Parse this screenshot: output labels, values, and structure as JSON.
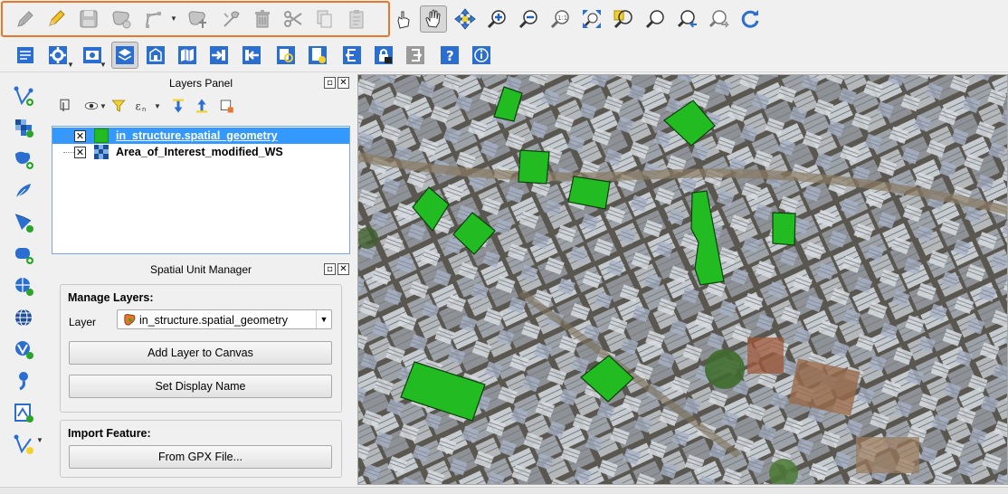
{
  "toolbar_top": {
    "edit_group": [
      "toggle-editing-icon",
      "pencil-icon",
      "save-edits-icon",
      "add-feature-icon",
      "node-tool-icon",
      "move-feature-icon",
      "vertex-tool-icon",
      "delete-icon",
      "cut-icon",
      "copy-icon",
      "paste-icon"
    ],
    "navigation": [
      "touch-icon",
      "pan-icon",
      "pan-to-selection-icon",
      "zoom-in-icon",
      "zoom-out-icon",
      "zoom-native-icon",
      "zoom-full-icon",
      "zoom-to-selection-icon",
      "zoom-to-layer-icon",
      "zoom-last-icon",
      "zoom-next-icon",
      "refresh-icon"
    ]
  },
  "toolbar_second": [
    "new-project-icon",
    "options-icon",
    "view-options-icon",
    "layers-panel-icon",
    "properties-icon",
    "map-options-icon",
    "import-icon",
    "export-icon",
    "search-icon",
    "document-icon",
    "back-icon",
    "lock-icon",
    "forward-icon",
    "help-icon",
    "info-icon"
  ],
  "left_toolbar": [
    "new-layer-icon",
    "raster-icon",
    "add-vector-icon",
    "feather-icon",
    "add-polygon-icon",
    "add-shape-icon",
    "wms-icon",
    "globe-icon",
    "vertex-edit-icon",
    "curve-icon",
    "map-edit-icon",
    "digitize-icon"
  ],
  "layers_panel": {
    "title": "Layers Panel",
    "layers": [
      {
        "name": "in_structure.spatial_geometry",
        "checked": "✕",
        "selected": true
      },
      {
        "name": "Area_of_Interest_modified_WS",
        "checked": "✕",
        "selected": false
      }
    ]
  },
  "spatial_unit_manager": {
    "title": "Spatial Unit Manager",
    "manage_layers": {
      "title": "Manage Layers:",
      "layer_label": "Layer",
      "layer_value": "in_structure.spatial_geometry",
      "add_button": "Add Layer to Canvas",
      "display_name_button": "Set Display Name"
    },
    "import_feature": {
      "title": "Import Feature:",
      "gpx_button": "From GPX File..."
    }
  },
  "colors": {
    "accent": "#e8762b",
    "selection": "#3399ff",
    "polygon_fill": "#22bb22"
  }
}
